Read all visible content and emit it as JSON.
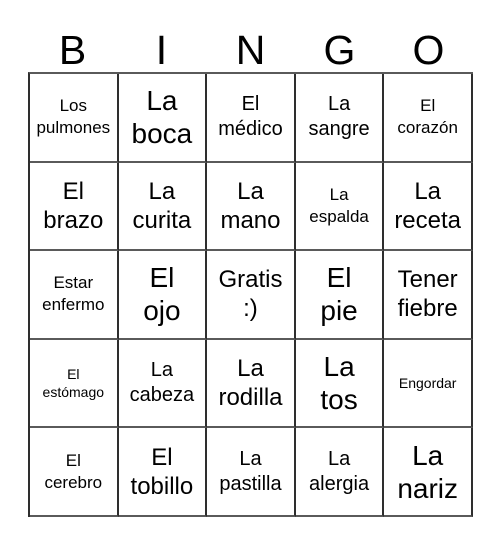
{
  "card": {
    "title": "BINGO",
    "headers": [
      "B",
      "I",
      "N",
      "G",
      "O"
    ],
    "rows": [
      [
        {
          "line1": "Los",
          "line2": "pulmones",
          "size": "fs-s"
        },
        {
          "line1": "La",
          "line2": "boca",
          "size": "fs-xl"
        },
        {
          "line1": "El",
          "line2": "médico",
          "size": "fs-m"
        },
        {
          "line1": "La",
          "line2": "sangre",
          "size": "fs-m"
        },
        {
          "line1": "El",
          "line2": "corazón",
          "size": "fs-s"
        }
      ],
      [
        {
          "line1": "El",
          "line2": "brazo",
          "size": "fs-l"
        },
        {
          "line1": "La",
          "line2": "curita",
          "size": "fs-l"
        },
        {
          "line1": "La",
          "line2": "mano",
          "size": "fs-l"
        },
        {
          "line1": "La",
          "line2": "espalda",
          "size": "fs-s"
        },
        {
          "line1": "La",
          "line2": "receta",
          "size": "fs-l"
        }
      ],
      [
        {
          "line1": "Estar",
          "line2": "enfermo",
          "size": "fs-s"
        },
        {
          "line1": "El",
          "line2": "ojo",
          "size": "fs-xl"
        },
        {
          "line1": "Gratis",
          "line2": ":)",
          "size": "fs-l"
        },
        {
          "line1": "El",
          "line2": "pie",
          "size": "fs-xl"
        },
        {
          "line1": "Tener",
          "line2": "fiebre",
          "size": "fs-l"
        }
      ],
      [
        {
          "line1": "El",
          "line2": "estómago",
          "size": "fs-xs"
        },
        {
          "line1": "La",
          "line2": "cabeza",
          "size": "fs-m"
        },
        {
          "line1": "La",
          "line2": "rodilla",
          "size": "fs-l"
        },
        {
          "line1": "La",
          "line2": "tos",
          "size": "fs-xl"
        },
        {
          "line1": "Engordar",
          "line2": "",
          "size": "fs-xs"
        }
      ],
      [
        {
          "line1": "El",
          "line2": "cerebro",
          "size": "fs-s"
        },
        {
          "line1": "El",
          "line2": "tobillo",
          "size": "fs-l"
        },
        {
          "line1": "La",
          "line2": "pastilla",
          "size": "fs-m"
        },
        {
          "line1": "La",
          "line2": "alergia",
          "size": "fs-m"
        },
        {
          "line1": "La",
          "line2": "nariz",
          "size": "fs-xl"
        }
      ]
    ]
  }
}
